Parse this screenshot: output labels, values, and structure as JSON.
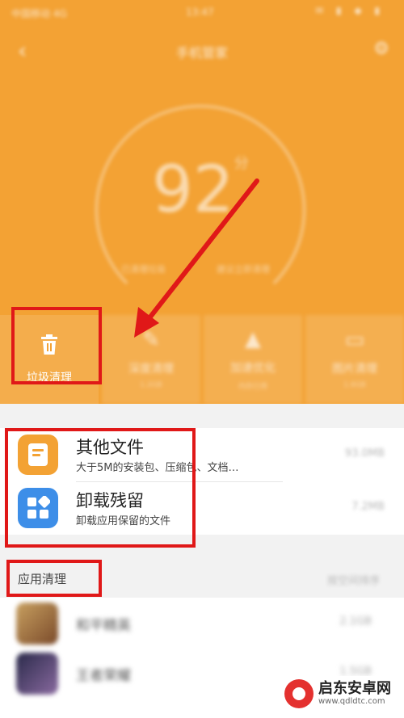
{
  "colors": {
    "header_bg": "#f3a234",
    "highlight": "#e01818",
    "file_icon": "#f3a234",
    "residue_icon": "#3d8ee8"
  },
  "status_bar": {
    "carrier": "中国移动 4G",
    "time": "13:47",
    "system_icons": "✉ ▮ ◆ ▮"
  },
  "nav": {
    "back_icon": "chevron-left-icon",
    "title": "手机管家",
    "settings_icon": "gear-icon"
  },
  "score": {
    "value": "92",
    "unit": "分",
    "left_note": "已清理垃圾",
    "right_note": "建议立即清理"
  },
  "tools": [
    {
      "icon": "trash-icon",
      "label": "垃圾清理",
      "sub": ""
    },
    {
      "icon": "broom-icon",
      "label": "深度清理",
      "sub": "1.2GB"
    },
    {
      "icon": "rocket-icon",
      "label": "加速优化",
      "sub": "内存已用"
    },
    {
      "icon": "image-icon",
      "label": "图片清理",
      "sub": "1.6GB"
    }
  ],
  "list": {
    "items": [
      {
        "icon": "document-icon",
        "title": "其他文件",
        "desc": "大于5M的安装包、压缩包、文档…",
        "size": "93.0MB"
      },
      {
        "icon": "app-grid-icon",
        "title": "卸载残留",
        "desc": "卸载应用保留的文件",
        "size": "7.2MB"
      }
    ]
  },
  "section": {
    "title": "应用清理",
    "right": "按空间排序"
  },
  "apps": [
    {
      "name": "和平精英",
      "size": "2.1GB"
    },
    {
      "name": "王者荣耀",
      "size": "1.5GB"
    }
  ],
  "watermark": {
    "name": "启东安卓网",
    "url": "www.qdldtc.com"
  }
}
